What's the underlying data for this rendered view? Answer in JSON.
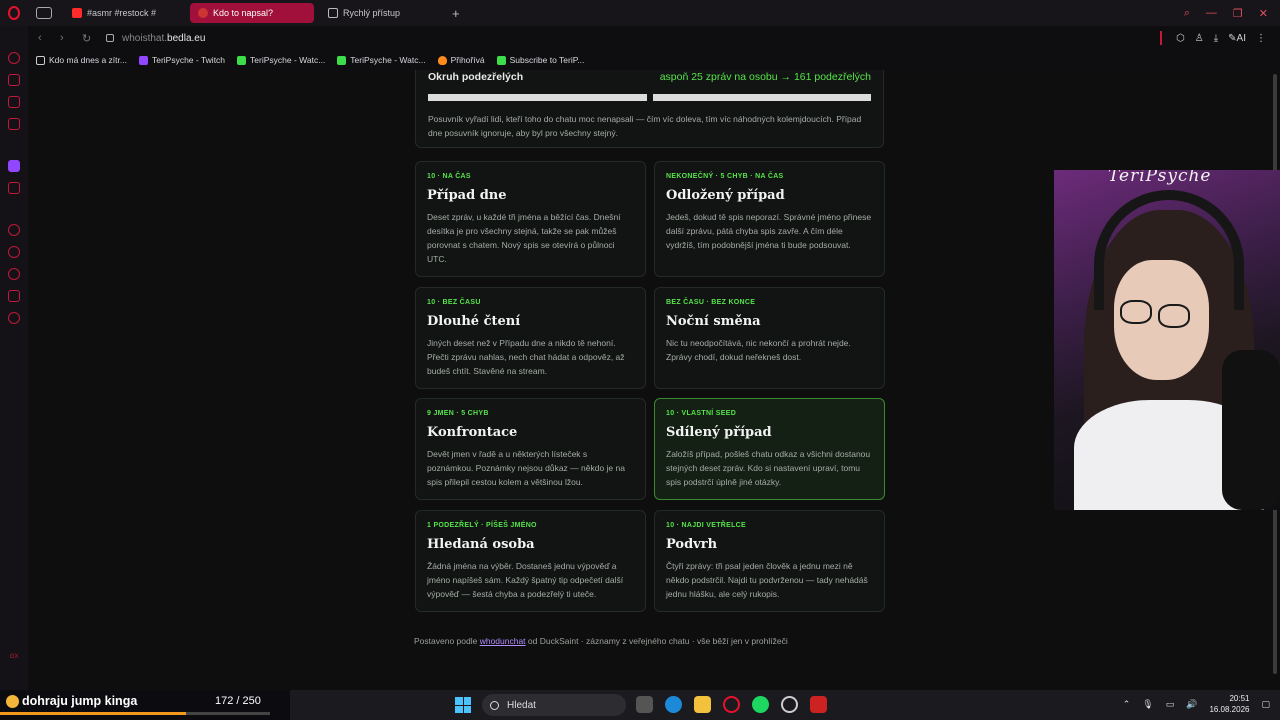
{
  "browser": {
    "tabs": [
      {
        "label": "#asmr #restock #",
        "active": false
      },
      {
        "label": "Kdo to napsal?",
        "active": true
      },
      {
        "label": "Rychlý přístup",
        "active": false
      }
    ],
    "url_prefix": "whoisthat.",
    "url_domain": "bedla.eu",
    "ai_label": "AI",
    "bookmarks": [
      {
        "label": "Kdo má dnes a zítr...",
        "icon": "doc"
      },
      {
        "label": "TeriPsyche - Twitch",
        "icon": "twitch"
      },
      {
        "label": "TeriPsyche - Watc...",
        "icon": "kick"
      },
      {
        "label": "TeriPsyche - Watc...",
        "icon": "kick"
      },
      {
        "label": "Přihořívá",
        "icon": "fire"
      },
      {
        "label": "Subscribe to TeriP...",
        "icon": "kick"
      }
    ]
  },
  "slider": {
    "title": "Okruh podezřelých",
    "value_text": "aspoň 25 zpráv na osobu → 161 podezřelých",
    "description": "Posuvník vyřadí lidi, kteří toho do chatu moc nenapsali — čím víc doleva, tím víc náhodných kolemjdoucích. Případ dne posuvník ignoruje, aby byl pro všechny stejný."
  },
  "modes": [
    {
      "tag": "10 · NA ČAS",
      "title": "Případ dne",
      "desc": "Deset zpráv, u každé tři jména a běžící čas. Dnešní desítka je pro všechny stejná, takže se pak můžeš porovnat s chatem. Nový spis se otevírá o půlnoci UTC."
    },
    {
      "tag": "NEKONEČNÝ · 5 CHYB · NA ČAS",
      "title": "Odložený případ",
      "desc": "Jedeš, dokud tě spis neporazí. Správné jméno přinese další zprávu, pátá chyba spis zavře. A čím déle vydržíš, tím podobnější jména ti bude podsouvat."
    },
    {
      "tag": "10 · BEZ ČASU",
      "title": "Dlouhé čtení",
      "desc": "Jiných deset než v Případu dne a nikdo tě nehoní. Přečti zprávu nahlas, nech chat hádat a odpověz, až budeš chtít. Stavěné na stream."
    },
    {
      "tag": "BEZ ČASU · BEZ KONCE",
      "title": "Noční směna",
      "desc": "Nic tu neodpočítává, nic nekončí a prohrát nejde. Zprávy chodí, dokud neřekneš dost."
    },
    {
      "tag": "9 JMEN · 5 CHYB",
      "title": "Konfrontace",
      "desc": "Devět jmen v řadě a u některých lísteček s poznámkou. Poznámky nejsou důkaz — někdo je na spis přilepil cestou kolem a většinou lžou."
    },
    {
      "tag": "10 · VLASTNÍ SEED",
      "title": "Sdílený případ",
      "desc": "Založíš případ, pošleš chatu odkaz a všichni dostanou stejných deset zpráv. Kdo si nastavení upraví, tomu spis podstrčí úplně jiné otázky."
    },
    {
      "tag": "1 PODEZŘELÝ · PÍŠEŠ JMÉNO",
      "title": "Hledaná osoba",
      "desc": "Žádná jména na výběr. Dostaneš jednu výpověď a jméno napíšeš sám. Každý špatný tip odpečetí další výpověď — šestá chyba a podezřelý ti uteče."
    },
    {
      "tag": "10 · NAJDI VETŘELCE",
      "title": "Podvrh",
      "desc": "Čtyři zprávy: tři psal jeden člověk a jednu mezi ně někdo podstrčil. Najdi tu podvrženou — tady nehádáš jednu hlášku, ale celý rukopis."
    }
  ],
  "footer": {
    "prefix": "Postaveno podle ",
    "link": "whodunchat",
    "suffix": " od DuckSaint · záznamy z veřejného chatu · vše běží jen v prohlížeči"
  },
  "webcam": {
    "label": "TeriPsyche"
  },
  "stream_overlay": {
    "goal_text": "dohraju jump kinga",
    "count": "172 / 250",
    "progress": 0.688
  },
  "taskbar": {
    "search_placeholder": "Hledat",
    "time": "20:51",
    "date": "16.08.2026"
  },
  "colors": {
    "accent_green": "#57e34b",
    "opera_red": "#e8112d",
    "tab_active": "#a0103a"
  }
}
